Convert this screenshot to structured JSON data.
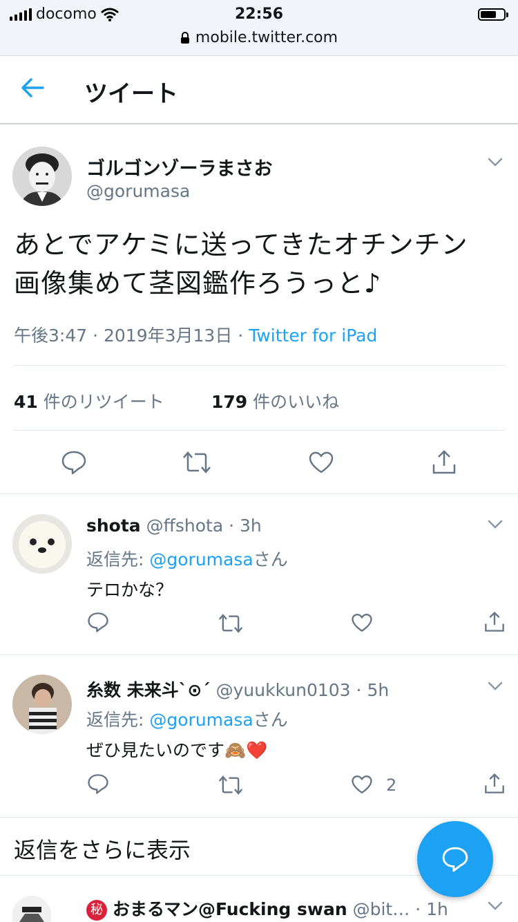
{
  "status_bar": {
    "carrier": "docomo",
    "time": "22:56",
    "url": "mobile.twitter.com",
    "battery_level": 0.7
  },
  "header": {
    "title": "ツイート"
  },
  "main_tweet": {
    "display_name": "ゴルゴンゾーラまさお",
    "handle": "@gorumasa",
    "text_line1": "あとでアケミに送ってきたオチンチン",
    "text_line2": "画像集めて茎図鑑作ろうっと♪",
    "time": "午後3:47",
    "date": "2019年3月13日",
    "source": "Twitter for iPad",
    "separator": "·",
    "retweet_count": "41",
    "retweet_label": "件のリツイート",
    "like_count": "179",
    "like_label": "件のいいね"
  },
  "replies": [
    {
      "display_name": "shota",
      "handle": "@ffshota",
      "time": "3h",
      "reply_prefix": "返信先:",
      "mention": "@gorumasa",
      "mention_suffix": "さん",
      "text": "テロかな？",
      "like_count": ""
    },
    {
      "display_name": "糸数 未来斗`⊙´",
      "handle": "@yuukkun0103",
      "time": "5h",
      "reply_prefix": "返信先:",
      "mention": "@gorumasa",
      "mention_suffix": "さん",
      "text": "ぜひ見たいのです🙈❤️",
      "like_count": "2"
    }
  ],
  "more_replies_label": "返信をさらに表示",
  "partial_reply": {
    "badge": "秘",
    "display_name": "おまるマン@Fucking swan",
    "handle": "@bit…",
    "time": "1h"
  },
  "colors": {
    "accent": "#1da1f2",
    "secondary_text": "#657786",
    "divider": "#e1e8ed"
  }
}
